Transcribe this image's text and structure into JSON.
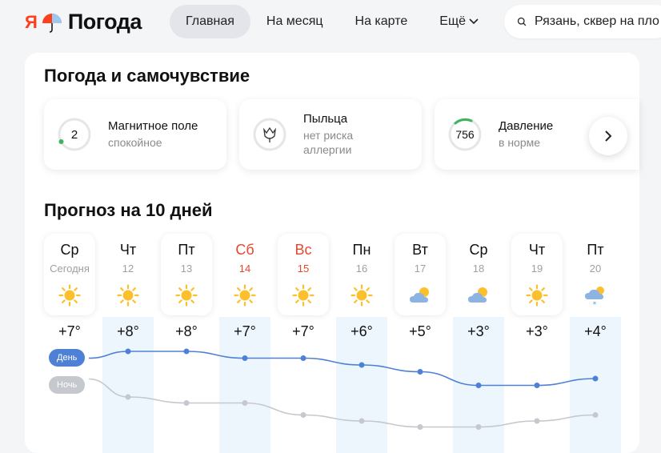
{
  "header": {
    "logo_mark": "Я",
    "logo_text": "Погода",
    "nav": [
      {
        "label": "Главная",
        "active": true
      },
      {
        "label": "На месяц",
        "active": false
      },
      {
        "label": "На карте",
        "active": false
      },
      {
        "label": "Ещё",
        "active": false
      }
    ],
    "search": {
      "value": "Рязань, сквер на пло"
    }
  },
  "wellbeing": {
    "title": "Погода и самочувствие",
    "cards": [
      {
        "title": "Магнитное поле",
        "gauge_value": "2",
        "subtitle": [
          "спокойное"
        ],
        "icon": "gauge-icon"
      },
      {
        "title": "Пыльца",
        "subtitle": [
          "нет риска",
          "аллергии"
        ],
        "icon": "tulip-icon"
      },
      {
        "title": "Давление",
        "gauge_value": "756",
        "subtitle": [
          "в норме"
        ],
        "icon": "gauge-icon"
      }
    ]
  },
  "forecast": {
    "title": "Прогноз на 10 дней",
    "day_label": "День",
    "night_label": "Ночь",
    "days": [
      {
        "name": "Ср",
        "date": "Сегодня",
        "weekend": false,
        "icon": "sun-icon",
        "temp": "+7°",
        "card": true
      },
      {
        "name": "Чт",
        "date": "12",
        "weekend": false,
        "icon": "sun-icon",
        "temp": "+8°",
        "card": false
      },
      {
        "name": "Пт",
        "date": "13",
        "weekend": false,
        "icon": "sun-icon",
        "temp": "+8°",
        "card": true
      },
      {
        "name": "Сб",
        "date": "14",
        "weekend": true,
        "icon": "sun-icon",
        "temp": "+7°",
        "card": false
      },
      {
        "name": "Вс",
        "date": "15",
        "weekend": true,
        "icon": "sun-icon",
        "temp": "+7°",
        "card": true
      },
      {
        "name": "Пн",
        "date": "16",
        "weekend": false,
        "icon": "sun-icon",
        "temp": "+6°",
        "card": false
      },
      {
        "name": "Вт",
        "date": "17",
        "weekend": false,
        "icon": "partly-cloudy-icon",
        "temp": "+5°",
        "card": true
      },
      {
        "name": "Ср",
        "date": "18",
        "weekend": false,
        "icon": "partly-cloudy-icon",
        "temp": "+3°",
        "card": false
      },
      {
        "name": "Чт",
        "date": "19",
        "weekend": false,
        "icon": "sun-icon",
        "temp": "+3°",
        "card": true
      },
      {
        "name": "Пт",
        "date": "20",
        "weekend": false,
        "icon": "cloud-snow-icon",
        "temp": "+4°",
        "card": false
      }
    ],
    "day_temps": [
      7,
      8,
      8,
      7,
      7,
      6,
      5,
      3,
      3,
      4
    ],
    "night_temps": [
      3,
      0,
      -1,
      -1,
      -3,
      -4,
      -5,
      -5,
      -4,
      -3
    ],
    "colors": {
      "day": "#4e81d6",
      "night": "#c5c8cd",
      "weekend": "#e5482e",
      "sun": "#fcc02d"
    }
  }
}
